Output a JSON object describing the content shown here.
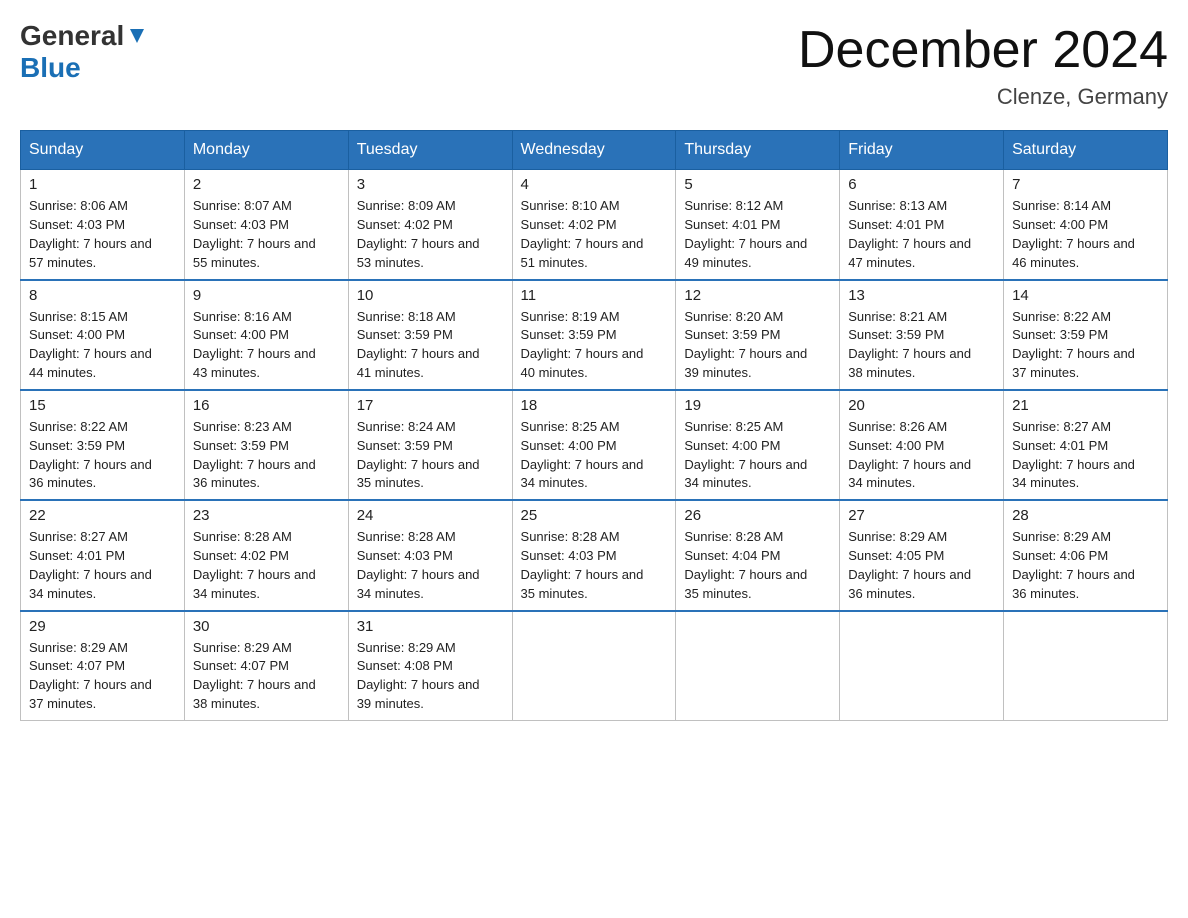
{
  "header": {
    "logo_general": "General",
    "logo_blue": "Blue",
    "month_title": "December 2024",
    "location": "Clenze, Germany"
  },
  "days_of_week": [
    "Sunday",
    "Monday",
    "Tuesday",
    "Wednesday",
    "Thursday",
    "Friday",
    "Saturday"
  ],
  "weeks": [
    [
      {
        "day": "1",
        "sunrise": "8:06 AM",
        "sunset": "4:03 PM",
        "daylight": "7 hours and 57 minutes."
      },
      {
        "day": "2",
        "sunrise": "8:07 AM",
        "sunset": "4:03 PM",
        "daylight": "7 hours and 55 minutes."
      },
      {
        "day": "3",
        "sunrise": "8:09 AM",
        "sunset": "4:02 PM",
        "daylight": "7 hours and 53 minutes."
      },
      {
        "day": "4",
        "sunrise": "8:10 AM",
        "sunset": "4:02 PM",
        "daylight": "7 hours and 51 minutes."
      },
      {
        "day": "5",
        "sunrise": "8:12 AM",
        "sunset": "4:01 PM",
        "daylight": "7 hours and 49 minutes."
      },
      {
        "day": "6",
        "sunrise": "8:13 AM",
        "sunset": "4:01 PM",
        "daylight": "7 hours and 47 minutes."
      },
      {
        "day": "7",
        "sunrise": "8:14 AM",
        "sunset": "4:00 PM",
        "daylight": "7 hours and 46 minutes."
      }
    ],
    [
      {
        "day": "8",
        "sunrise": "8:15 AM",
        "sunset": "4:00 PM",
        "daylight": "7 hours and 44 minutes."
      },
      {
        "day": "9",
        "sunrise": "8:16 AM",
        "sunset": "4:00 PM",
        "daylight": "7 hours and 43 minutes."
      },
      {
        "day": "10",
        "sunrise": "8:18 AM",
        "sunset": "3:59 PM",
        "daylight": "7 hours and 41 minutes."
      },
      {
        "day": "11",
        "sunrise": "8:19 AM",
        "sunset": "3:59 PM",
        "daylight": "7 hours and 40 minutes."
      },
      {
        "day": "12",
        "sunrise": "8:20 AM",
        "sunset": "3:59 PM",
        "daylight": "7 hours and 39 minutes."
      },
      {
        "day": "13",
        "sunrise": "8:21 AM",
        "sunset": "3:59 PM",
        "daylight": "7 hours and 38 minutes."
      },
      {
        "day": "14",
        "sunrise": "8:22 AM",
        "sunset": "3:59 PM",
        "daylight": "7 hours and 37 minutes."
      }
    ],
    [
      {
        "day": "15",
        "sunrise": "8:22 AM",
        "sunset": "3:59 PM",
        "daylight": "7 hours and 36 minutes."
      },
      {
        "day": "16",
        "sunrise": "8:23 AM",
        "sunset": "3:59 PM",
        "daylight": "7 hours and 36 minutes."
      },
      {
        "day": "17",
        "sunrise": "8:24 AM",
        "sunset": "3:59 PM",
        "daylight": "7 hours and 35 minutes."
      },
      {
        "day": "18",
        "sunrise": "8:25 AM",
        "sunset": "4:00 PM",
        "daylight": "7 hours and 34 minutes."
      },
      {
        "day": "19",
        "sunrise": "8:25 AM",
        "sunset": "4:00 PM",
        "daylight": "7 hours and 34 minutes."
      },
      {
        "day": "20",
        "sunrise": "8:26 AM",
        "sunset": "4:00 PM",
        "daylight": "7 hours and 34 minutes."
      },
      {
        "day": "21",
        "sunrise": "8:27 AM",
        "sunset": "4:01 PM",
        "daylight": "7 hours and 34 minutes."
      }
    ],
    [
      {
        "day": "22",
        "sunrise": "8:27 AM",
        "sunset": "4:01 PM",
        "daylight": "7 hours and 34 minutes."
      },
      {
        "day": "23",
        "sunrise": "8:28 AM",
        "sunset": "4:02 PM",
        "daylight": "7 hours and 34 minutes."
      },
      {
        "day": "24",
        "sunrise": "8:28 AM",
        "sunset": "4:03 PM",
        "daylight": "7 hours and 34 minutes."
      },
      {
        "day": "25",
        "sunrise": "8:28 AM",
        "sunset": "4:03 PM",
        "daylight": "7 hours and 35 minutes."
      },
      {
        "day": "26",
        "sunrise": "8:28 AM",
        "sunset": "4:04 PM",
        "daylight": "7 hours and 35 minutes."
      },
      {
        "day": "27",
        "sunrise": "8:29 AM",
        "sunset": "4:05 PM",
        "daylight": "7 hours and 36 minutes."
      },
      {
        "day": "28",
        "sunrise": "8:29 AM",
        "sunset": "4:06 PM",
        "daylight": "7 hours and 36 minutes."
      }
    ],
    [
      {
        "day": "29",
        "sunrise": "8:29 AM",
        "sunset": "4:07 PM",
        "daylight": "7 hours and 37 minutes."
      },
      {
        "day": "30",
        "sunrise": "8:29 AM",
        "sunset": "4:07 PM",
        "daylight": "7 hours and 38 minutes."
      },
      {
        "day": "31",
        "sunrise": "8:29 AM",
        "sunset": "4:08 PM",
        "daylight": "7 hours and 39 minutes."
      },
      null,
      null,
      null,
      null
    ]
  ]
}
